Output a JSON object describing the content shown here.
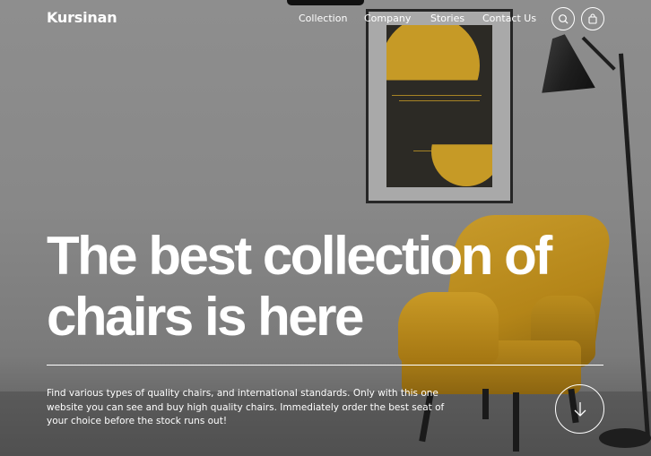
{
  "brand": {
    "name": "Kursinan"
  },
  "nav": {
    "links": [
      {
        "label": "Collection"
      },
      {
        "label": "Company"
      },
      {
        "label": "Stories"
      },
      {
        "label": "Contact Us"
      }
    ],
    "icons": [
      "search-icon",
      "shopping-bag-icon"
    ]
  },
  "hero": {
    "headline_line1": "The best collection of",
    "headline_line2": "chairs is here",
    "description": "Find various types of quality chairs, and international standards. Only with this one website you can see and buy high quality chairs. Immediately order the best seat of your choice before the stock runs out!",
    "scroll_icon": "arrow-down-icon"
  },
  "colors": {
    "accent": "#c69a26",
    "text": "#ffffff",
    "wall": "#888888"
  }
}
